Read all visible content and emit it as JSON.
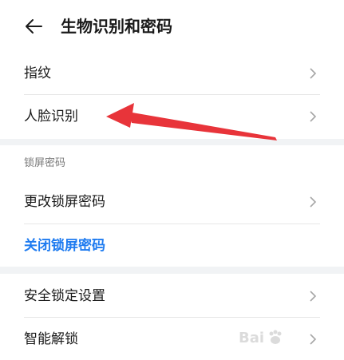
{
  "header": {
    "title": "生物识别和密码"
  },
  "biometrics": [
    {
      "label": "指纹"
    },
    {
      "label": "人脸识别"
    }
  ],
  "lock_section": {
    "title": "锁屏密码",
    "change_label": "更改锁屏密码",
    "close_label": "关闭锁屏密码"
  },
  "security": [
    {
      "label": "安全锁定设置"
    },
    {
      "label": "智能解锁"
    }
  ],
  "colors": {
    "accent": "#1e7bf0",
    "annotation_arrow": "#e8343a",
    "background": "#f1f3f5"
  },
  "watermark": {
    "text": "Bai"
  }
}
